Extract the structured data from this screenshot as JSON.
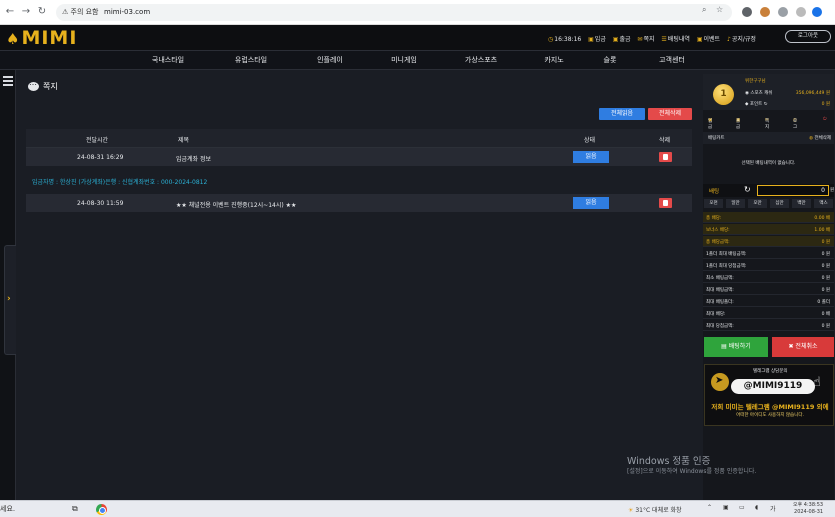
{
  "browser": {
    "security_label": "주의 요함",
    "url": "mimi-03.com"
  },
  "site": {
    "logo": "MIMI",
    "time": "16:38:16",
    "top_links": [
      "입금",
      "출금",
      "쪽지",
      "배팅내역",
      "이벤트",
      "공지/규정"
    ],
    "logout": "로그아웃"
  },
  "nav": [
    "국내스타일",
    "유럽스타일",
    "인플레이",
    "미니게임",
    "가상스포츠",
    "카지노",
    "슬롯",
    "고객센터"
  ],
  "page": {
    "title": "쪽지",
    "read_all": "전체읽음",
    "delete_all": "전체삭제"
  },
  "table": {
    "headers": [
      "전달시간",
      "제목",
      "상태",
      "삭제"
    ],
    "rows": [
      {
        "time": "24-08-31 16:29",
        "subject": "입금계좌 정보",
        "status": "읽음"
      },
      {
        "time": "24-08-30 11:59",
        "subject": "★★ 채널전용 이벤트 진행중(12시~14시) ★★",
        "status": "읽음"
      }
    ],
    "detail_text": "입금자명 : 한상진 (가상계좌)은행 : 신협계좌번호 : 000-2024-0812"
  },
  "sidebar": {
    "user_name": "위한구구님",
    "sports_cash_label": "스포츠 캐쉬",
    "sports_cash_value": "356,096,449 원",
    "point_label": "포인트",
    "point_value": "0 원",
    "actions": [
      "입금",
      "출금",
      "쪽지",
      "로그"
    ],
    "betslip_title": "배팅카트",
    "betslip_clear": "전체삭제",
    "betslip_empty": "선택된 배팅내역이 없습니다.",
    "stake_label": "배팅",
    "stake_value": "0",
    "stake_unit": "원",
    "chips": [
      "오천",
      "일만",
      "오만",
      "십만",
      "백만",
      "맥스"
    ],
    "summary": [
      {
        "label": "총 배당:",
        "value": "0.00 배"
      },
      {
        "label": "보너스 배당:",
        "value": "1.00 배"
      },
      {
        "label": "총 배당금액:",
        "value": "0 원"
      },
      {
        "label": "1폴더 최대 배팅금액:",
        "value": "0 원"
      },
      {
        "label": "1폴더 최대 당첨금액:",
        "value": "0 원"
      },
      {
        "label": "최소 배팅금액:",
        "value": "0 원"
      },
      {
        "label": "최대 배팅금액:",
        "value": "0 원"
      },
      {
        "label": "최대 배팅폴더:",
        "value": "0 폴더"
      },
      {
        "label": "최대 배당:",
        "value": "0 배"
      },
      {
        "label": "최대 당첨금액:",
        "value": "0 원"
      }
    ],
    "bet_button": "배팅하기",
    "cancel_button": "전체취소",
    "banner": {
      "line1": "텔레그램 상담문의",
      "handle": "@MIMI9119",
      "line3": "저희 미미는 텔레그램 @MIMI9119 외에",
      "line4": "어떠한 아이디도 사용하지 않습니다."
    }
  },
  "windows": {
    "watermark_title": "Windows 정품 인증",
    "watermark_sub": "[설정]으로 이동하여 Windows를 정품 인증합니다.",
    "search_text": "세요.",
    "weather": "31°C 대체로 화창",
    "time": "오후 4:38:53",
    "date": "2024-08-31"
  },
  "colors": {
    "accent_gold": "#e7b11d",
    "button_blue": "#2f7de1",
    "button_red": "#e44a4a",
    "button_green": "#2fa43c"
  }
}
